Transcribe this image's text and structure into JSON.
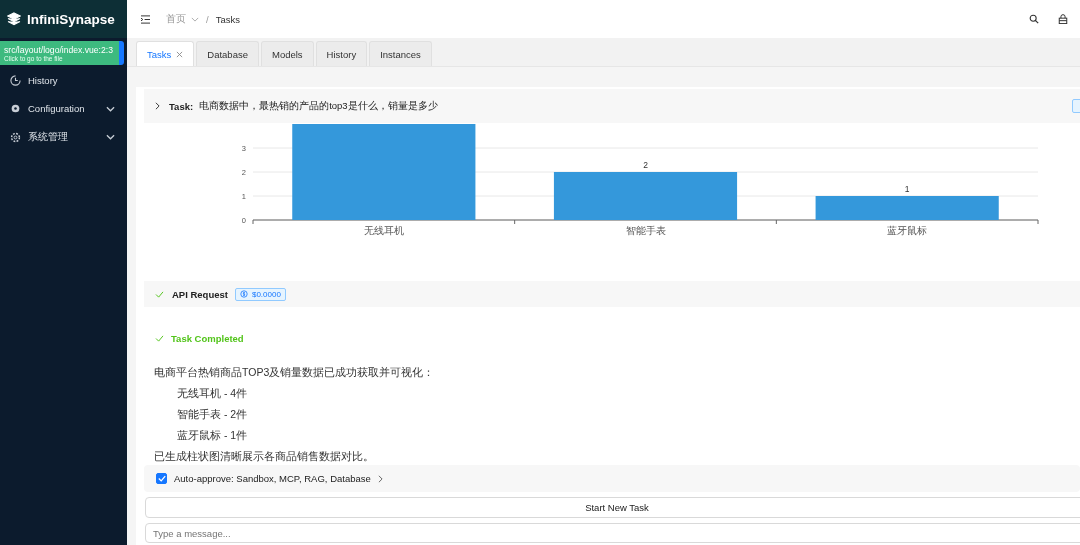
{
  "sidebar": {
    "logo": "InfiniSynapse",
    "items": [
      {
        "label": "History",
        "expandable": false
      },
      {
        "label": "Configuration",
        "expandable": true
      },
      {
        "label": "系统管理",
        "expandable": true
      }
    ]
  },
  "dev_tooltip": {
    "path": "src/layout/logo/index.vue:2:3",
    "hint": "Click to go to the file"
  },
  "breadcrumb": [
    "首页",
    "Tasks"
  ],
  "breadcrumb_separator": "/",
  "tabs": [
    {
      "label": "Tasks",
      "selected": true,
      "closable": true
    },
    {
      "label": "Database",
      "selected": false,
      "closable": false
    },
    {
      "label": "Models",
      "selected": false,
      "closable": false
    },
    {
      "label": "History",
      "selected": false,
      "closable": false
    },
    {
      "label": "Instances",
      "selected": false,
      "closable": false
    }
  ],
  "task": {
    "label": "Task:",
    "text": "电商数据中，最热销的产品的top3是什么，销量是多少"
  },
  "chart_data": {
    "type": "bar",
    "categories": [
      "无线耳机",
      "智能手表",
      "蓝牙鼠标"
    ],
    "grid": true,
    "series": [
      {
        "color": "#3498db",
        "values": [
          4,
          2,
          1
        ]
      }
    ],
    "ylim": [
      0,
      4
    ],
    "yticks": [
      0,
      1,
      2,
      3
    ],
    "value_labels": [
      null,
      "2",
      "1"
    ]
  },
  "api_request": {
    "label": "API Request",
    "cost": "$0.0000"
  },
  "completed": {
    "label": "Task Completed"
  },
  "result": {
    "intro": "电商平台热销商品TOP3及销量数据已成功获取并可视化：",
    "items": [
      "无线耳机 - 4件",
      "智能手表 - 2件",
      "蓝牙鼠标 - 1件"
    ],
    "outro": "已生成柱状图清晰展示各商品销售数据对比。"
  },
  "auto_approve": {
    "label": "Auto-approve: Sandbox, MCP, RAG, Database",
    "checked": true
  },
  "start_button": "Start New Task",
  "message": {
    "placeholder": "Type a message..."
  }
}
